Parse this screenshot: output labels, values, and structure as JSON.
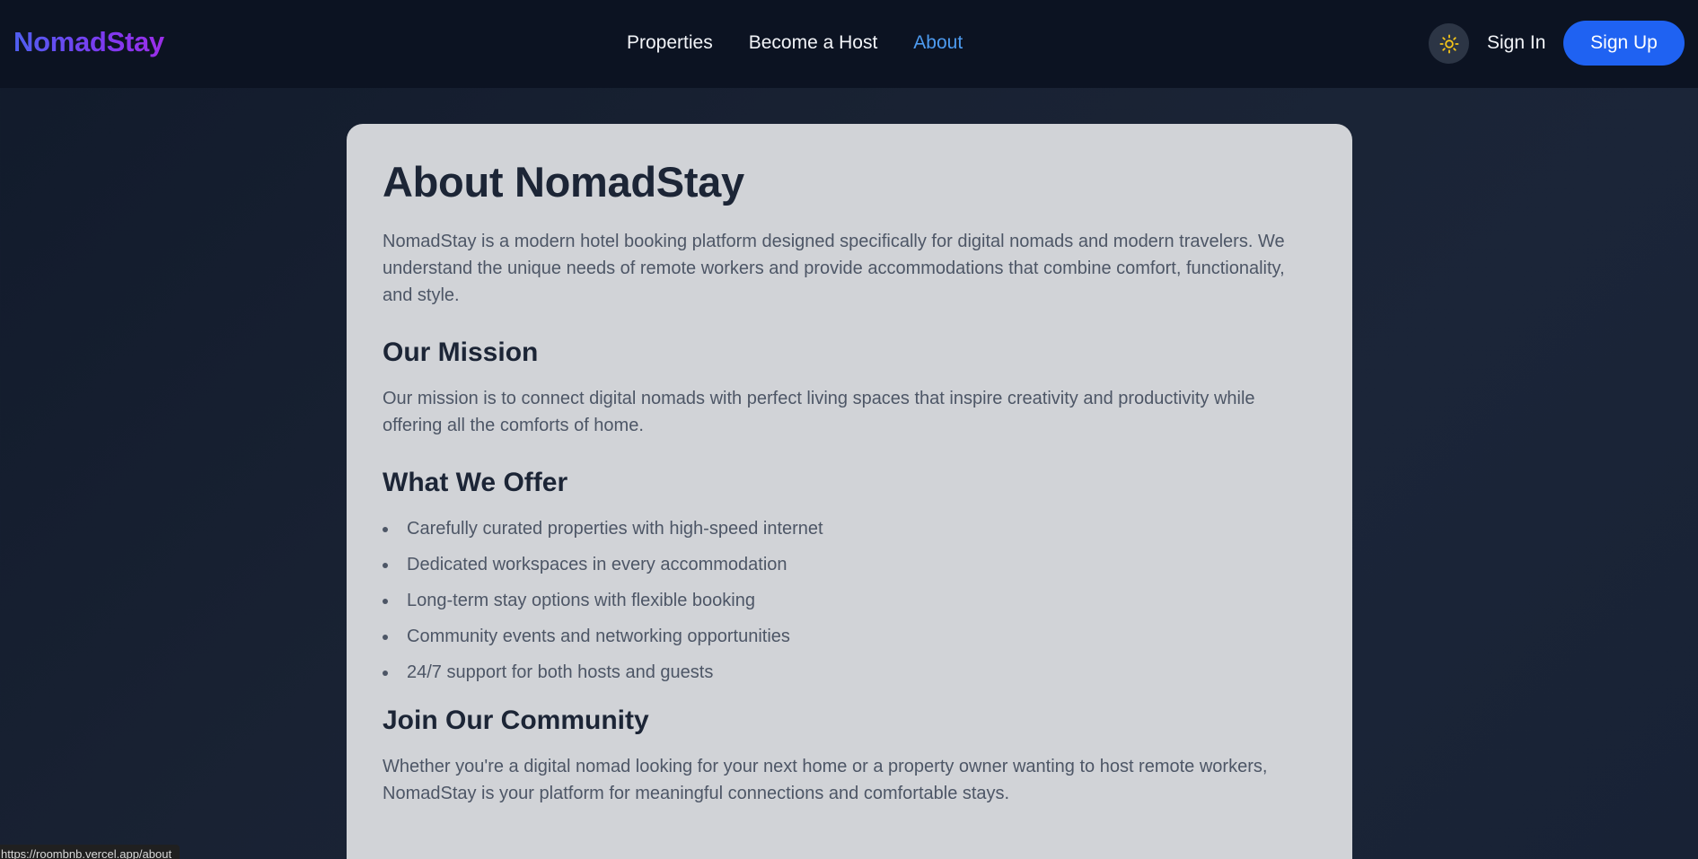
{
  "header": {
    "brand": "NomadStay",
    "nav": [
      {
        "label": "Properties",
        "active": false
      },
      {
        "label": "Become a Host",
        "active": false
      },
      {
        "label": "About",
        "active": true
      }
    ],
    "theme_toggle_icon": "sun-icon",
    "sign_in_label": "Sign In",
    "sign_up_label": "Sign Up"
  },
  "about": {
    "title": "About NomadStay",
    "intro": "NomadStay is a modern hotel booking platform designed specifically for digital nomads and modern travelers. We understand the unique needs of remote workers and provide accommodations that combine comfort, functionality, and style.",
    "mission": {
      "heading": "Our Mission",
      "text": "Our mission is to connect digital nomads with perfect living spaces that inspire creativity and productivity while offering all the comforts of home."
    },
    "offer": {
      "heading": "What We Offer",
      "items": [
        "Carefully curated properties with high-speed internet",
        "Dedicated workspaces in every accommodation",
        "Long-term stay options with flexible booking",
        "Community events and networking opportunities",
        "24/7 support for both hosts and guests"
      ]
    },
    "community": {
      "heading": "Join Our Community",
      "text": "Whether you're a digital nomad looking for your next home or a property owner wanting to host remote workers, NomadStay is your platform for meaningful connections and comfortable stays."
    }
  },
  "status_bar": {
    "url": "https://roombnb.vercel.app/about"
  },
  "colors": {
    "page_bg": "#151e2f",
    "navbar_bg": "#0c1322",
    "card_bg": "#d1d3d7",
    "accent_blue": "#1f62f2",
    "active_link": "#4d9bf0",
    "brand_gradient_start": "#4f5ff0",
    "brand_gradient_end": "#9b2ee8",
    "sun_icon": "#f5c518"
  }
}
